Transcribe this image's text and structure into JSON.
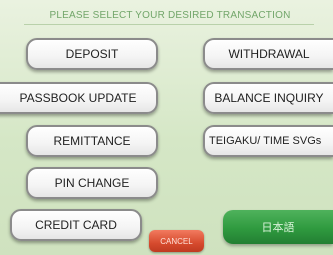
{
  "header": {
    "title": "PLEASE SELECT YOUR DESIRED TRANSACTION"
  },
  "buttons": {
    "deposit": "DEPOSIT",
    "withdrawal": "WITHDRAWAL",
    "passbook_update": "PASSBOOK UPDATE",
    "balance_inquiry": "BALANCE INQUIRY",
    "remittance": "REMITTANCE",
    "teigaku": "TEIGAKU/ TIME SVGs",
    "pin_change": "PIN CHANGE",
    "credit_card": "CREDIT CARD",
    "japanese": "日本語",
    "cancel": "CANCEL"
  },
  "colors": {
    "background": "#d7e8c8",
    "header_text": "#72a66a",
    "japanese_button": "#2f9a3f",
    "cancel_button": "#d64b2e"
  }
}
